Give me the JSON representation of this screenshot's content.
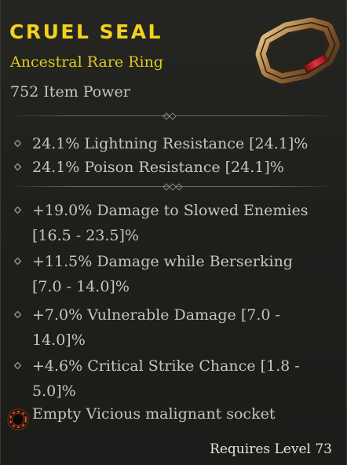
{
  "item": {
    "name": "CRUEL SEAL",
    "type_line": "Ancestral Rare Ring",
    "item_power": "752 Item Power",
    "image_icon": "ring-icon"
  },
  "implicits": [
    "24.1% Lightning Resistance [24.1]%",
    "24.1% Poison Resistance [24.1]%"
  ],
  "affixes": [
    "+19.0% Damage to Slowed Enemies [16.5 - 23.5]%",
    "+11.5% Damage while Berserking [7.0 - 14.0]%",
    "+7.0% Vulnerable Damage [7.0 - 14.0]%",
    "+4.6% Critical Strike Chance [1.8 - 5.0]%"
  ],
  "socket": {
    "label": "Empty Vicious malignant socket",
    "icon": "malignant-socket-icon"
  },
  "requirement": "Requires Level 73",
  "colors": {
    "title": "#f2d21a",
    "subtitle": "#e0c81c",
    "body_text": "#c9c5bb",
    "background": "#1f1f1c"
  }
}
